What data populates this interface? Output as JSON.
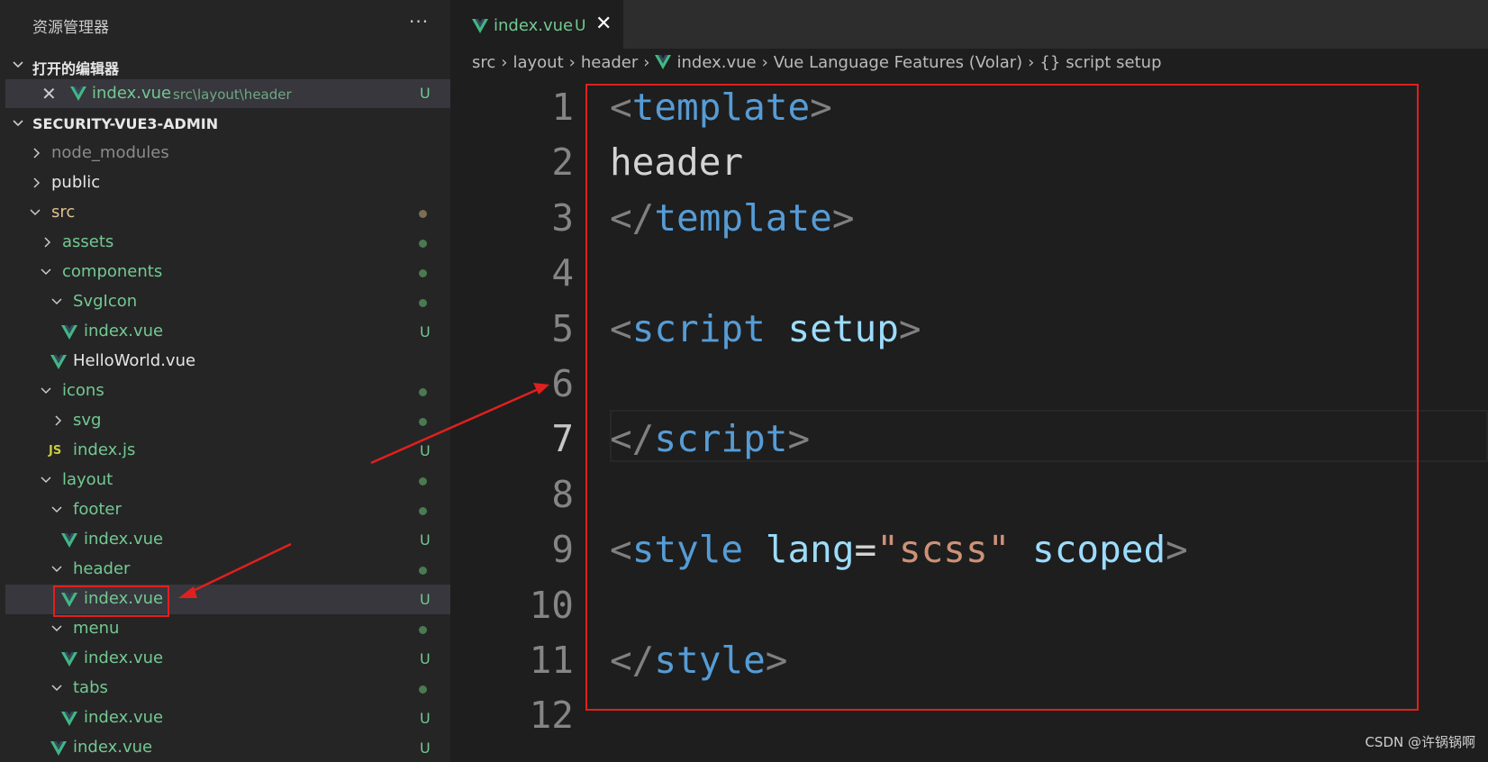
{
  "colors": {
    "sidebar_bg": "#252526",
    "editor_bg": "#1e1e1e",
    "selection_bg": "#37373d",
    "untracked_green": "#73c991",
    "highlight_red": "#e0201e",
    "vue_logo": "#41b883"
  },
  "explorer": {
    "title": "资源管理器",
    "more_icon": "ellipsis-icon",
    "open_editors": {
      "header": "打开的编辑器",
      "items": [
        {
          "name": "index.vue",
          "path": "src\\layout\\header",
          "badge": "U"
        }
      ]
    },
    "project": {
      "header": "SECURITY-VUE3-ADMIN",
      "rows": [
        {
          "label": "node_modules"
        },
        {
          "label": "public"
        },
        {
          "label": "src"
        },
        {
          "label": "assets"
        },
        {
          "label": "components"
        },
        {
          "label": "SvgIcon"
        },
        {
          "label": "index.vue",
          "badge": "U"
        },
        {
          "label": "HelloWorld.vue"
        },
        {
          "label": "icons"
        },
        {
          "label": "svg"
        },
        {
          "label": "index.js",
          "badge": "U",
          "icon_text": "JS"
        },
        {
          "label": "layout"
        },
        {
          "label": "footer"
        },
        {
          "label": "index.vue",
          "badge": "U"
        },
        {
          "label": "header"
        },
        {
          "label": "index.vue",
          "badge": "U"
        },
        {
          "label": "menu"
        },
        {
          "label": "index.vue",
          "badge": "U"
        },
        {
          "label": "tabs"
        },
        {
          "label": "index.vue",
          "badge": "U"
        },
        {
          "label": "index.vue",
          "badge": "U"
        }
      ]
    }
  },
  "editor": {
    "tab": {
      "name": "index.vue",
      "badge": "U"
    },
    "breadcrumb": {
      "parts": [
        "src",
        "layout",
        "header",
        "index.vue",
        "Vue Language Features (Volar)",
        "script setup"
      ],
      "symbol_icon": "{}"
    },
    "lines": [
      {
        "number": "1",
        "tokens": [
          [
            "<",
            "punc"
          ],
          [
            "template",
            "tag"
          ],
          [
            ">",
            "punc"
          ]
        ]
      },
      {
        "number": "2",
        "tokens": [
          [
            "header",
            "text"
          ]
        ]
      },
      {
        "number": "3",
        "tokens": [
          [
            "</",
            "punc"
          ],
          [
            "template",
            "tag"
          ],
          [
            ">",
            "punc"
          ]
        ]
      },
      {
        "number": "4",
        "tokens": []
      },
      {
        "number": "5",
        "tokens": [
          [
            "<",
            "punc"
          ],
          [
            "script",
            "tag"
          ],
          [
            " ",
            "text"
          ],
          [
            "setup",
            "attr"
          ],
          [
            ">",
            "punc"
          ]
        ]
      },
      {
        "number": "6",
        "tokens": []
      },
      {
        "number": "7",
        "tokens": [
          [
            "</",
            "punc"
          ],
          [
            "script",
            "tag"
          ],
          [
            ">",
            "punc"
          ]
        ],
        "active": true
      },
      {
        "number": "8",
        "tokens": []
      },
      {
        "number": "9",
        "tokens": [
          [
            "<",
            "punc"
          ],
          [
            "style",
            "tag"
          ],
          [
            " ",
            "text"
          ],
          [
            "lang",
            "attr"
          ],
          [
            "=",
            "eq"
          ],
          [
            "\"scss\"",
            "str"
          ],
          [
            " ",
            "text"
          ],
          [
            "scoped",
            "attr"
          ],
          [
            ">",
            "punc"
          ]
        ]
      },
      {
        "number": "10",
        "tokens": []
      },
      {
        "number": "11",
        "tokens": [
          [
            "</",
            "punc"
          ],
          [
            "style",
            "tag"
          ],
          [
            ">",
            "punc"
          ]
        ]
      },
      {
        "number": "12",
        "tokens": []
      }
    ]
  },
  "watermark": "CSDN @许锅锅啊"
}
